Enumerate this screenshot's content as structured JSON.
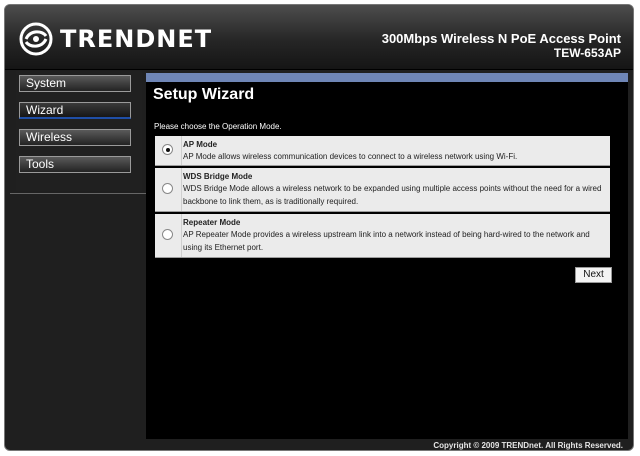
{
  "header": {
    "brand": "TRENDNET",
    "product_name": "300Mbps Wireless N PoE Access Point",
    "model": "TEW-653AP"
  },
  "sidebar": {
    "items": [
      {
        "label": "System"
      },
      {
        "label": "Wizard",
        "active": true
      },
      {
        "label": "Wireless"
      },
      {
        "label": "Tools"
      }
    ]
  },
  "main": {
    "title": "Setup Wizard",
    "prompt": "Please choose the Operation Mode.",
    "options": [
      {
        "title": "AP Mode",
        "description": "AP Mode allows wireless communication devices to connect to a wireless network using Wi-Fi.",
        "selected": true
      },
      {
        "title": "WDS Bridge Mode",
        "description": "WDS Bridge Mode allows a wireless network to be expanded using multiple access points without the need for a wired backbone to link them, as is traditionally required.",
        "selected": false
      },
      {
        "title": "Repeater Mode",
        "description": "AP Repeater Mode provides a wireless upstream link into a network instead of being hard-wired to the network and using its Ethernet port.",
        "selected": false
      }
    ],
    "next_label": "Next"
  },
  "footer": {
    "copyright": "Copyright © 2009 TRENDnet. All Rights Reserved."
  },
  "colors": {
    "accent_bar": "#6f86b6",
    "active_nav_underline": "#1f4ea6",
    "background": "#1f1f1f"
  },
  "icons": {
    "logo": "trendnet-swirl-icon"
  }
}
